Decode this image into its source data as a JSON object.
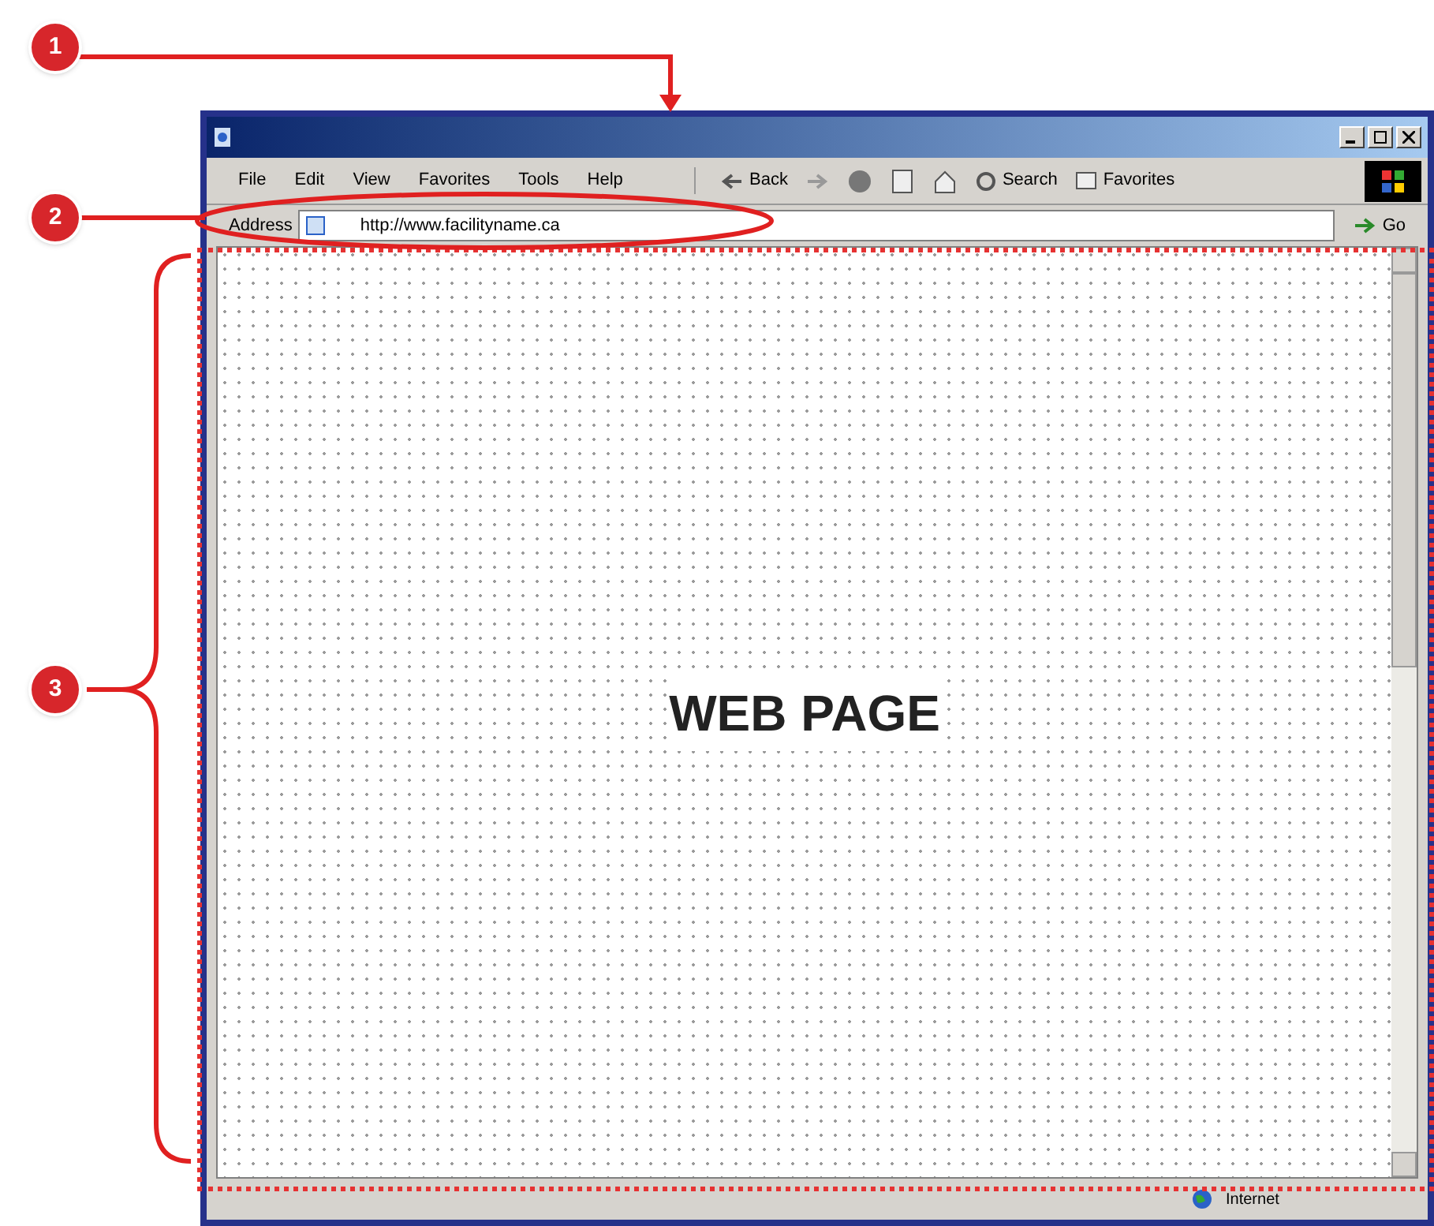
{
  "callouts": [
    {
      "number": "1"
    },
    {
      "number": "2"
    },
    {
      "number": "3"
    }
  ],
  "window": {
    "menu": [
      "File",
      "Edit",
      "View",
      "Favorites",
      "Tools",
      "Help"
    ],
    "toolbar": {
      "back": "Back",
      "search": "Search",
      "favorites": "Favorites"
    },
    "address": {
      "label": "Address",
      "value": "http://www.facilityname.ca",
      "go": "Go"
    },
    "page_label": "WEB PAGE",
    "status_bar": {
      "zone": "Internet"
    }
  }
}
